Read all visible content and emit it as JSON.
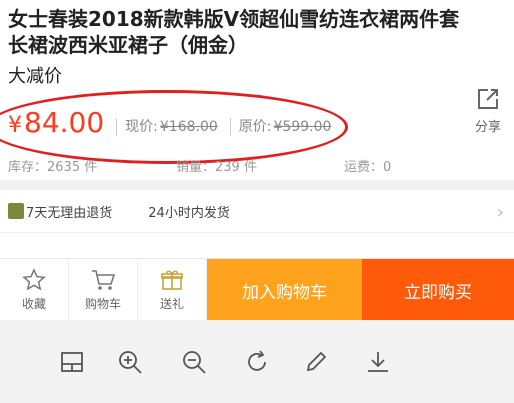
{
  "product": {
    "title": "女士春装2018新款韩版V领超仙雪纺连衣裙两件套长裙波西米亚裙子（佣金）",
    "promo": "大减价"
  },
  "price": {
    "symbol": "¥",
    "amount": "84.00",
    "current_label": "现价:",
    "current_value": "¥168.00",
    "original_label": "原价:",
    "original_value": "¥599.00"
  },
  "share": {
    "label": "分享",
    "icon": "share-icon"
  },
  "stats": {
    "stock": "库存：2635 件",
    "sales": "销量：239 件",
    "shipping": "运费：0"
  },
  "policy": {
    "return": "7天无理由退货",
    "ship": "24小时内发货"
  },
  "bottom_bar": {
    "favorite": "收藏",
    "cart": "购物车",
    "gift": "送礼",
    "add_to_cart": "加入购物车",
    "buy_now": "立即购买"
  },
  "colors": {
    "price": "#ff3a1f",
    "annotation_circle": "#e02020",
    "cart_button": "#ffa21d",
    "buy_button": "#ff5a0a"
  },
  "toolbar_icons": [
    "layout-icon",
    "zoom-in-icon",
    "zoom-out-icon",
    "rotate-icon",
    "edit-icon",
    "download-icon"
  ]
}
